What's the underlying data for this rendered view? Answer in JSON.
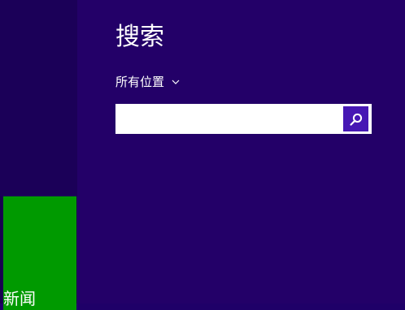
{
  "search": {
    "title": "搜索",
    "scope_label": "所有位置",
    "query_value": "",
    "placeholder": ""
  },
  "tiles": [
    {
      "label": "新闻",
      "color": "#009a00"
    }
  ],
  "icons": {
    "scope_dropdown": "chevron-down-icon",
    "search_submit": "search-icon"
  },
  "colors": {
    "pane_background": "#230068",
    "start_background": "#18004f",
    "search_button": "#4617b4"
  }
}
